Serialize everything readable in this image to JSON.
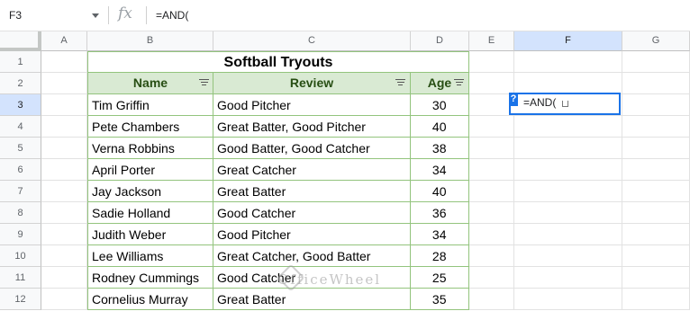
{
  "formula_bar": {
    "name_box": "F3",
    "fx": "fx",
    "formula": "=AND("
  },
  "columns": [
    "A",
    "B",
    "C",
    "D",
    "E",
    "F",
    "G"
  ],
  "rows": [
    "1",
    "2",
    "3",
    "4",
    "5",
    "6",
    "7",
    "8",
    "9",
    "10",
    "11",
    "12"
  ],
  "table": {
    "title": "Softball Tryouts",
    "headers": [
      "Name",
      "Review",
      "Age"
    ],
    "data": [
      [
        "Tim Griffin",
        "Good Pitcher",
        "30"
      ],
      [
        "Pete Chambers",
        "Great Batter, Good Pitcher",
        "40"
      ],
      [
        "Verna Robbins",
        "Good Batter, Good Catcher",
        "38"
      ],
      [
        "April Porter",
        "Great Catcher",
        "34"
      ],
      [
        "Jay Jackson",
        "Great Batter",
        "40"
      ],
      [
        "Sadie Holland",
        "Good Catcher",
        "36"
      ],
      [
        "Judith Weber",
        "Good Pitcher",
        "34"
      ],
      [
        "Lee Williams",
        "Great Catcher, Good Batter",
        "28"
      ],
      [
        "Rodney Cummings",
        "Good Catcher",
        "25"
      ],
      [
        "Cornelius Murray",
        "Great Batter",
        "35"
      ]
    ]
  },
  "active_cell": {
    "ref": "F3",
    "value": "=AND(",
    "help": "?"
  },
  "watermark": "OfficeWheel",
  "colors": {
    "header_fill": "#d9ead3",
    "header_text": "#274e13",
    "border_green": "#93c47d",
    "selection": "#1a73e8"
  }
}
